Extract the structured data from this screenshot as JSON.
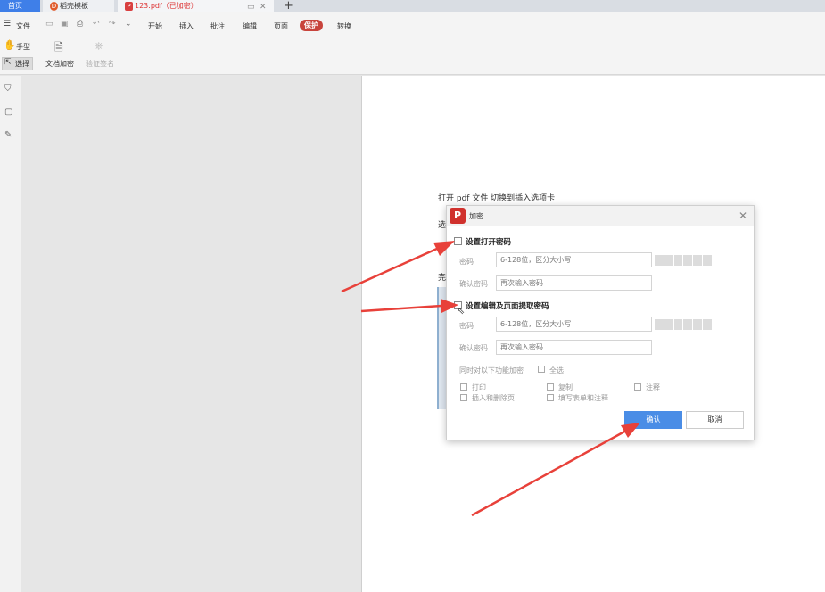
{
  "tabs": [
    {
      "label": "首页"
    },
    {
      "label": "稻壳模板"
    },
    {
      "label": "123.pdf（已加密）"
    }
  ],
  "menu": {
    "file": "文件",
    "items": [
      "开始",
      "插入",
      "批注",
      "编辑",
      "页面",
      "保护",
      "转换"
    ]
  },
  "ribbon": {
    "hand": "手型",
    "select": "选择",
    "doc_encrypt": "文档加密",
    "verify_sign": "验证签名"
  },
  "document": {
    "line1": "打开 pdf 文件   切换到插入选项卡",
    "line2": "选",
    "line3": "完"
  },
  "dialog": {
    "title": "加密",
    "section_open": "设置打开密码",
    "section_edit": "设置编辑及页面提取密码",
    "password_label": "密码",
    "confirm_label": "确认密码",
    "password_placeholder": "6-128位，区分大小写",
    "confirm_placeholder": "再次输入密码",
    "also_encrypt": "同时对以下功能加密",
    "select_all": "全选",
    "options": [
      "打印",
      "复制",
      "注释",
      "插入和删除页",
      "填写表单和注释"
    ],
    "ok": "确认",
    "cancel": "取消"
  },
  "colors": {
    "accent": "#4a8de6",
    "protect_tab": "#c8443c",
    "arrow": "#e8413a"
  }
}
